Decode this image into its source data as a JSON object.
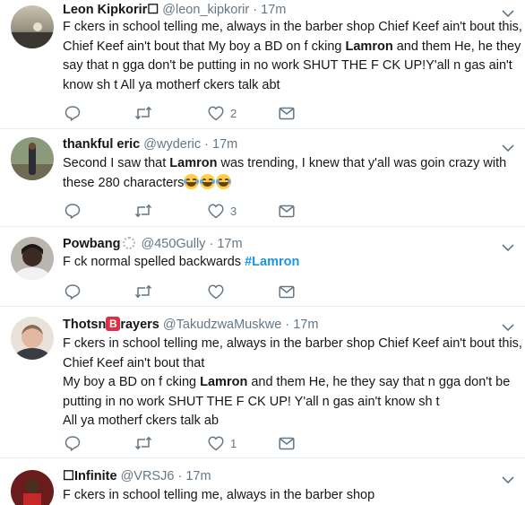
{
  "tweets": [
    {
      "name": "Leon Kipkorir☐",
      "handle": "@leon_kipkorir",
      "dot": "·",
      "time": "17m",
      "lines": [
        [
          "F  ckers in school telling me, always in the barber shop Chief Keef ain't bout this,"
        ],
        [
          "Chief Keef ain't bout that My boy a BD on f  cking ",
          "Lamron",
          " and them He, he they"
        ],
        [
          "say that n  gga don't be putting in no work SHUT THE F  CK UP!Y'all n  gas ain't"
        ],
        [
          "know sh  t All ya motherf  ckers talk abt"
        ]
      ],
      "likes": "2",
      "icons": [
        "reply-icon",
        "retweet-icon",
        "heart-icon",
        "dm-icon",
        "caret-down-icon"
      ]
    },
    {
      "name": "thankful eric",
      "handle": "@wyderic",
      "dot": "·",
      "time": "17m",
      "lines": [
        [
          "Second I saw that ",
          "Lamron",
          " was trending, I knew that y'all was goin crazy with"
        ],
        [
          "these 280 characters"
        ]
      ],
      "emoji": "face-with-tears-of-joy",
      "likes": "3"
    },
    {
      "name": "Powbang",
      "handle": "@450Gully",
      "dot": "·",
      "time": "17m",
      "lines": [
        [
          "F  ck normal spelled backwards ",
          "#Lamron"
        ]
      ],
      "likes": ""
    },
    {
      "name_part1": "Thotsn",
      "name_badge": "B",
      "name_part2": "rayers",
      "handle": "@TakudzwaMuskwe",
      "dot": "·",
      "time": "17m",
      "lines": [
        [
          "F  ckers in school telling me, always in the barber shop Chief Keef ain't bout this,"
        ],
        [
          "Chief Keef ain't bout that"
        ],
        [
          "My boy a BD on f  cking ",
          "Lamron",
          " and them He, he they say that n  gga don't be"
        ],
        [
          "putting in no work SHUT THE F  CK UP! Y'all n  gas ain't know sh  t"
        ],
        [
          "All ya motherf  ckers talk ab"
        ]
      ],
      "likes": "1"
    },
    {
      "name": "☐Infinite",
      "handle": "@VRSJ6",
      "dot": "·",
      "time": "17m",
      "lines": [
        [
          "F  ckers in school telling me, always in the barber shop"
        ]
      ]
    }
  ],
  "colors": {
    "accent": "#1b95e0",
    "muted": "#657786",
    "text": "#14171a",
    "divider": "#e6ecf0",
    "badge": "#dd2e44"
  }
}
